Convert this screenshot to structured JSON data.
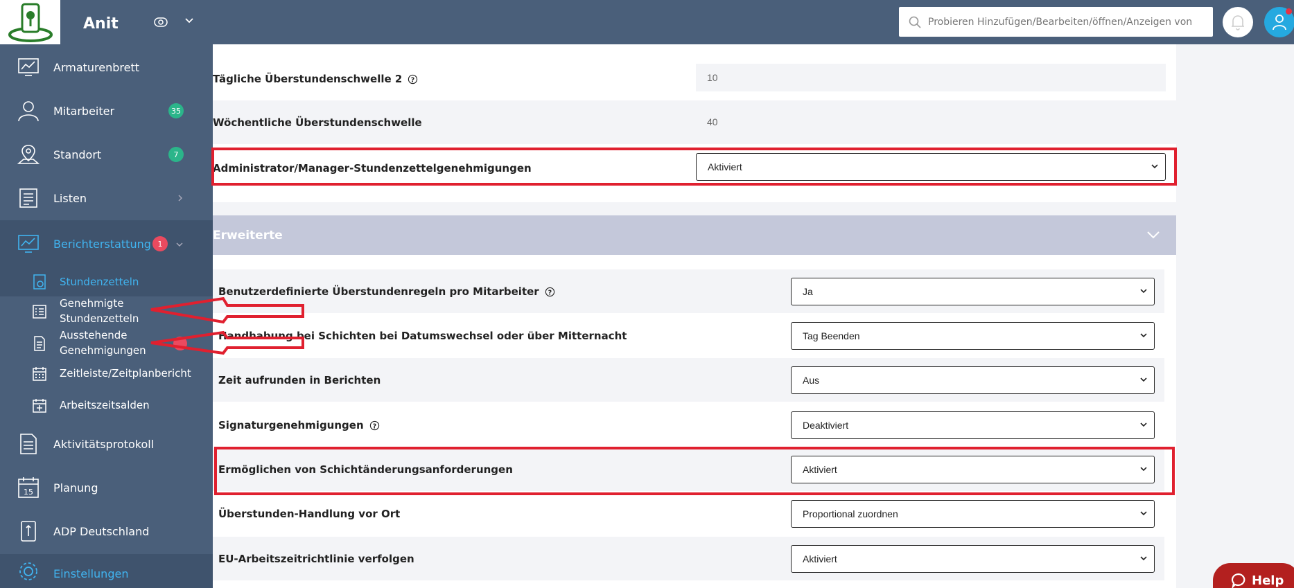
{
  "app": {
    "brand": "Anit"
  },
  "search": {
    "placeholder": "Probieren Hinzufügen/Bearbeiten/öffnen/Anzeigen von"
  },
  "sidebar": {
    "items": [
      {
        "label": "Armaturenbrett",
        "icon": "dashboard-icon"
      },
      {
        "label": "Mitarbeiter",
        "icon": "employee-icon",
        "badge": "35"
      },
      {
        "label": "Standort",
        "icon": "location-icon",
        "badge": "7"
      },
      {
        "label": "Listen",
        "icon": "list-icon"
      },
      {
        "label": "Berichterstattung",
        "icon": "report-chart-icon",
        "badge": "1"
      },
      {
        "label": "Aktivitätsprotokoll",
        "icon": "activity-log-icon"
      },
      {
        "label": "Planung",
        "icon": "calendar-icon"
      },
      {
        "label": "ADP Deutschland",
        "icon": "adp-icon"
      },
      {
        "label": "Einstellungen",
        "icon": "gear-icon"
      }
    ],
    "sub_items": [
      {
        "label": "Stundenzetteln"
      },
      {
        "label_line1": "Genehmigte",
        "label_line2": "Stundenzetteln"
      },
      {
        "label_line1": "Ausstehende",
        "label_line2": "Genehmigungen"
      },
      {
        "label": "Zeitleiste/Zeitplanbericht"
      },
      {
        "label": "Arbeitszeitsalden"
      }
    ]
  },
  "top_panel": {
    "rows": [
      {
        "label": "Tägliche Überstundenschwelle 2",
        "value": "10"
      },
      {
        "label": "Wöchentliche Überstundenschwelle",
        "value": "40"
      },
      {
        "label": "Administrator/Manager-Stundenzettelgenehmigungen",
        "value": "Aktiviert"
      }
    ]
  },
  "advanced": {
    "title": "Erweiterte",
    "rows": [
      {
        "label": "Benutzerdefinierte Überstundenregeln pro Mitarbeiter",
        "value": "Ja"
      },
      {
        "label": "Handhabung bei Schichten bei Datumswechsel oder über Mitternacht",
        "value": "Tag Beenden"
      },
      {
        "label": "Zeit aufrunden in Berichten",
        "value": "Aus"
      },
      {
        "label": "Signaturgenehmigungen",
        "value": "Deaktiviert"
      },
      {
        "label": "Ermöglichen von Schichtänderungsanforderungen",
        "value": "Aktiviert"
      },
      {
        "label": "Überstunden-Handlung vor Ort",
        "value": "Proportional zuordnen"
      },
      {
        "label": "EU-Arbeitszeitrichtlinie verfolgen",
        "value": "Aktiviert"
      }
    ]
  },
  "help": {
    "label": "Help"
  },
  "colors": {
    "sidebar": "#4a5f7a",
    "accent": "#40b4f0",
    "highlight": "#e0202f"
  }
}
